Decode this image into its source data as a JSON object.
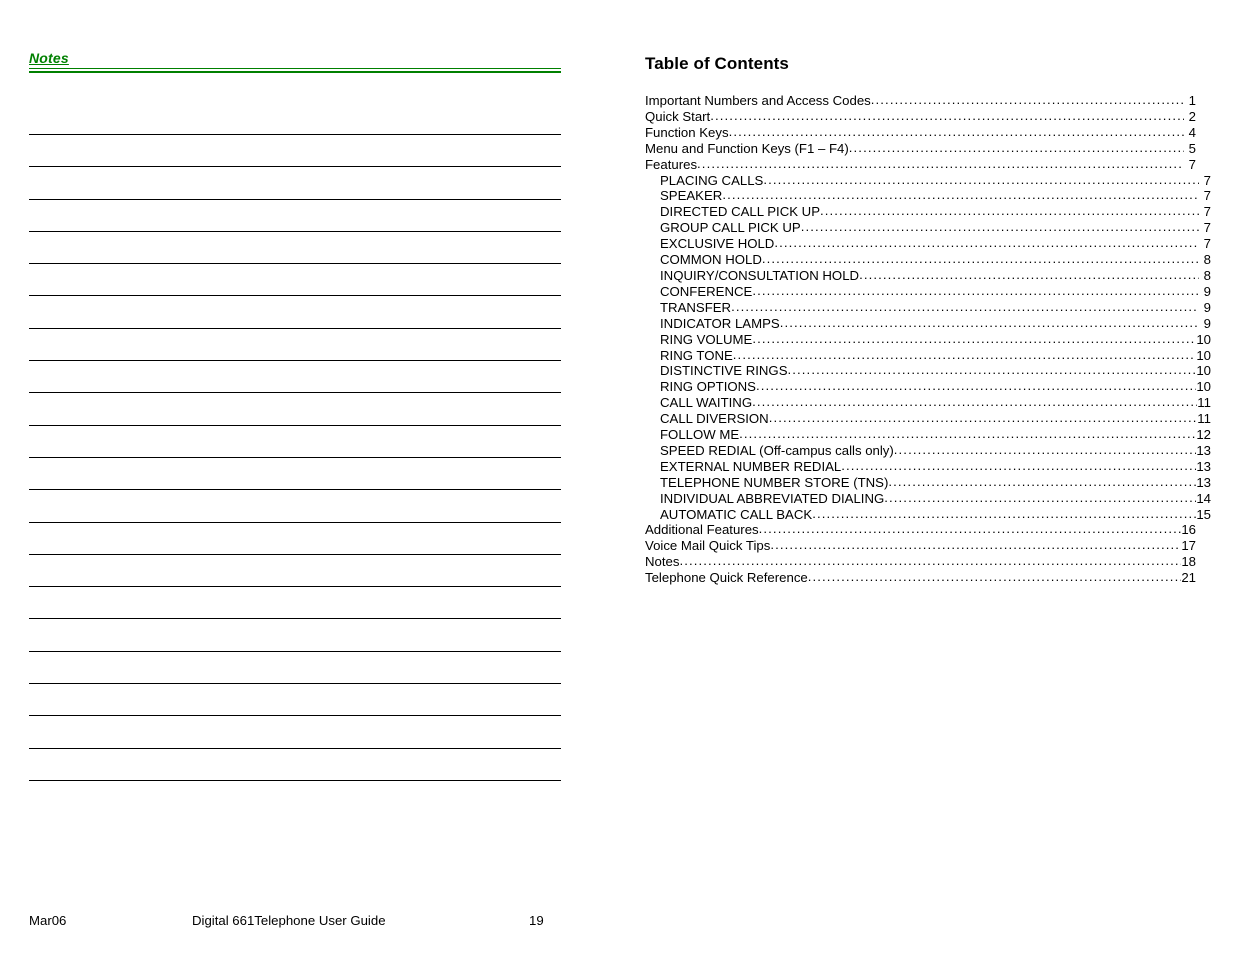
{
  "colors": {
    "heading_green": "#008000",
    "rule_green": "#008000",
    "text_black": "#000000",
    "page_background": "#ffffff"
  },
  "notes_section": {
    "heading": "Notes",
    "ruled_line_count": 21
  },
  "toc": {
    "title": "Table of Contents",
    "leader_char": ".",
    "entries": [
      {
        "label": "Important Numbers and Access Codes",
        "page": "1",
        "level": 1
      },
      {
        "label": "Quick Start",
        "page": "2",
        "level": 1
      },
      {
        "label": "Function Keys",
        "page": "4",
        "level": 1
      },
      {
        "label": "Menu and Function Keys (F1 – F4)",
        "page": "5",
        "level": 1
      },
      {
        "label": "Features",
        "page": "7",
        "level": 1
      },
      {
        "label": "PLACING CALLS",
        "page": "7",
        "level": 2
      },
      {
        "label": "SPEAKER",
        "page": "7",
        "level": 2
      },
      {
        "label": "DIRECTED CALL PICK UP",
        "page": "7",
        "level": 2
      },
      {
        "label": "GROUP CALL PICK UP",
        "page": "7",
        "level": 2
      },
      {
        "label": "EXCLUSIVE HOLD",
        "page": "7",
        "level": 2
      },
      {
        "label": "COMMON HOLD",
        "page": "8",
        "level": 2
      },
      {
        "label": "INQUIRY/CONSULTATION HOLD",
        "page": "8",
        "level": 2
      },
      {
        "label": "CONFERENCE",
        "page": "9",
        "level": 2
      },
      {
        "label": "TRANSFER",
        "page": "9",
        "level": 2
      },
      {
        "label": "INDICATOR LAMPS",
        "page": "9",
        "level": 2
      },
      {
        "label": "RING VOLUME",
        "page": "10",
        "level": 2
      },
      {
        "label": "RING TONE",
        "page": "10",
        "level": 2
      },
      {
        "label": "DISTINCTIVE RINGS",
        "page": "10",
        "level": 2
      },
      {
        "label": "RING OPTIONS",
        "page": "10",
        "level": 2
      },
      {
        "label": "CALL WAITING",
        "page": "11",
        "level": 2
      },
      {
        "label": "CALL DIVERSION",
        "page": "11",
        "level": 2
      },
      {
        "label": "FOLLOW ME",
        "page": "12",
        "level": 2
      },
      {
        "label": "SPEED REDIAL (Off-campus calls only)",
        "page": "13",
        "level": 2
      },
      {
        "label": "EXTERNAL NUMBER REDIAL",
        "page": "13",
        "level": 2
      },
      {
        "label": "TELEPHONE NUMBER STORE (TNS)",
        "page": "13",
        "level": 2
      },
      {
        "label": "INDIVIDUAL ABBREVIATED DIALING",
        "page": "14",
        "level": 2
      },
      {
        "label": "AUTOMATIC CALL BACK",
        "page": "15",
        "level": 2
      },
      {
        "label": "Additional Features",
        "page": "16",
        "level": 1
      },
      {
        "label": "Voice Mail Quick Tips",
        "page": "17",
        "level": 1
      },
      {
        "label": "Notes",
        "page": "18",
        "level": 1
      },
      {
        "label": "Telephone Quick Reference",
        "page": "21",
        "level": 1
      }
    ]
  },
  "footer": {
    "date": "Mar06",
    "title": "Digital 661Telephone User Guide",
    "page_number": "19"
  }
}
